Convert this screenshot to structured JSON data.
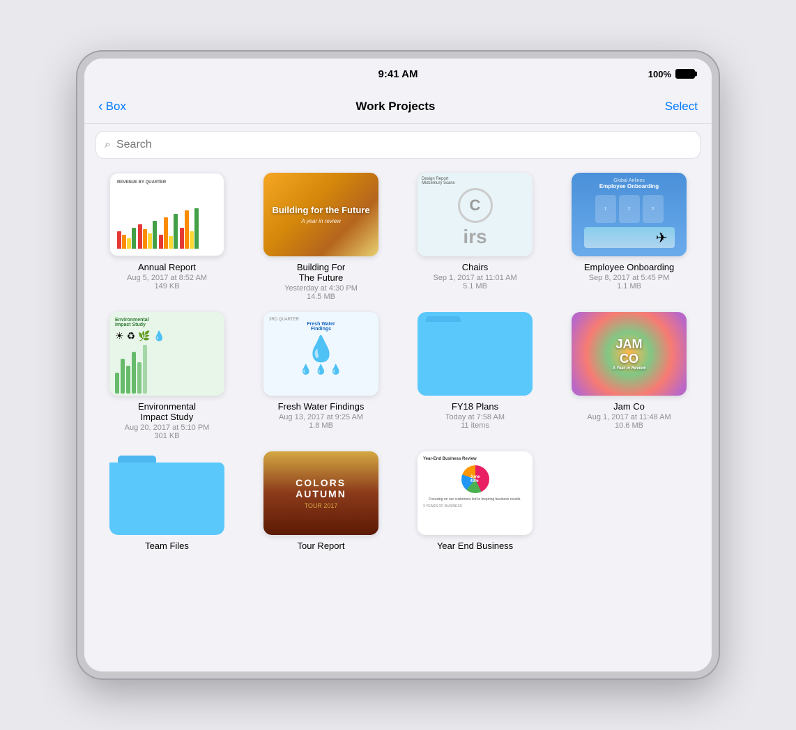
{
  "statusBar": {
    "time": "9:41 AM",
    "battery": "100%"
  },
  "navBar": {
    "backLabel": "Box",
    "title": "Work Projects",
    "selectLabel": "Select"
  },
  "search": {
    "placeholder": "Search"
  },
  "files": [
    {
      "id": "annual-report",
      "name": "Annual Report",
      "date": "Aug 5, 2017 at 8:52 AM",
      "size": "149 KB",
      "type": "document"
    },
    {
      "id": "building-for-future",
      "name": "Building For The Future",
      "date": "Yesterday at 4:30 PM",
      "size": "14.5 MB",
      "type": "document"
    },
    {
      "id": "chairs",
      "name": "Chairs",
      "date": "Sep 1, 2017 at 11:01 AM",
      "size": "5.1 MB",
      "type": "document"
    },
    {
      "id": "employee-onboarding",
      "name": "Employee Onboarding",
      "date": "Sep 8, 2017 at 5:45 PM",
      "size": "1.1 MB",
      "type": "document"
    },
    {
      "id": "environmental-impact",
      "name": "Environmental Impact Study",
      "date": "Aug 20, 2017 at 5:10 PM",
      "size": "301 KB",
      "type": "document"
    },
    {
      "id": "fresh-water",
      "name": "Fresh Water Findings",
      "date": "Aug 13, 2017 at 9:25 AM",
      "size": "1.8 MB",
      "type": "document"
    },
    {
      "id": "fy18-plans",
      "name": "FY18 Plans",
      "date": "Today at 7:58 AM",
      "size": "11 items",
      "type": "folder"
    },
    {
      "id": "jam-co",
      "name": "Jam Co",
      "date": "Aug 1, 2017 at 11:48 AM",
      "size": "10.6 MB",
      "type": "document"
    },
    {
      "id": "team-files",
      "name": "Team Files",
      "date": "",
      "size": "",
      "type": "folder"
    },
    {
      "id": "tour-report",
      "name": "Tour Report",
      "date": "",
      "size": "",
      "type": "document"
    },
    {
      "id": "year-end-business",
      "name": "Year End Business",
      "date": "",
      "size": "",
      "type": "document"
    }
  ]
}
